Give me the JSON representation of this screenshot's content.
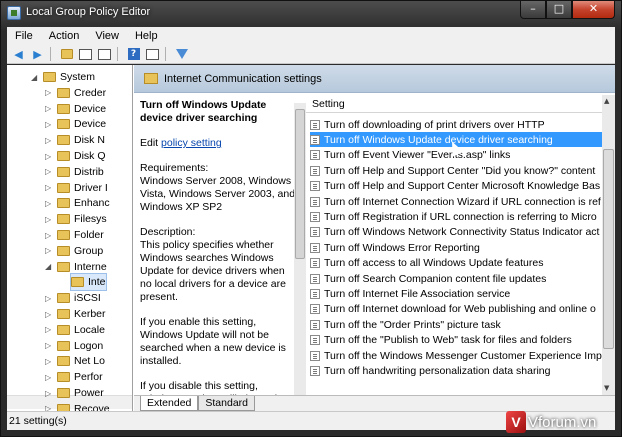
{
  "window": {
    "title": "Local Group Policy Editor"
  },
  "window_buttons": {
    "minimize": "–",
    "maximize": "□",
    "close": "✕"
  },
  "menu": [
    "File",
    "Action",
    "View",
    "Help"
  ],
  "tree": {
    "items": [
      {
        "label": "System",
        "expanded": true
      },
      {
        "label": "Creder"
      },
      {
        "label": "Device"
      },
      {
        "label": "Device"
      },
      {
        "label": "Disk N"
      },
      {
        "label": "Disk Q"
      },
      {
        "label": "Distrib"
      },
      {
        "label": "Driver I"
      },
      {
        "label": "Enhanc"
      },
      {
        "label": "Filesys"
      },
      {
        "label": "Folder"
      },
      {
        "label": "Group"
      },
      {
        "label": "Interne",
        "expanded": true
      },
      {
        "label": "Inte",
        "selected": true
      },
      {
        "label": "iSCSI"
      },
      {
        "label": "Kerber"
      },
      {
        "label": "Locale"
      },
      {
        "label": "Logon"
      },
      {
        "label": "Net Lo"
      },
      {
        "label": "Perfor"
      },
      {
        "label": "Power"
      },
      {
        "label": "Recove"
      }
    ]
  },
  "header": {
    "title": "Internet Communication settings"
  },
  "description": {
    "title": "Turn off Windows Update device driver searching",
    "edit_prefix": "Edit",
    "edit_link": "policy setting",
    "requirements": "Requirements:\nWindows Server 2008, Windows Vista, Windows Server 2003, and Windows XP SP2",
    "body1": "Description:\nThis policy specifies whether Windows searches Windows Update for device drivers when no local drivers for a device are present.",
    "body2": "If you enable this setting, Windows Update will not be searched when a new device is installed.",
    "body3": "If you disable this setting, Windows Update will always be"
  },
  "list": {
    "column": "Setting",
    "selected_index": 1,
    "rows": [
      "Turn off downloading of print drivers over HTTP",
      "Turn off Windows Update device driver searching",
      "Turn off Event Viewer \"Events.asp\" links",
      "Turn off Help and Support Center \"Did you know?\" content",
      "Turn off Help and Support Center Microsoft Knowledge Bas",
      "Turn off Internet Connection Wizard if URL connection is ref",
      "Turn off Registration if URL connection is referring to Micro",
      "Turn off Windows Network Connectivity Status Indicator act",
      "Turn off Windows Error Reporting",
      "Turn off access to all Windows Update features",
      "Turn off Search Companion content file updates",
      "Turn off Internet File Association service",
      "Turn off Internet download for Web publishing and online o",
      "Turn off the \"Order Prints\" picture task",
      "Turn off the \"Publish to Web\" task for files and folders",
      "Turn off the Windows Messenger Customer Experience Impr",
      "Turn off handwriting personalization data sharing"
    ]
  },
  "tabs": {
    "extended": "Extended",
    "standard": "Standard"
  },
  "status": {
    "text": "21 setting(s)"
  },
  "watermark": {
    "logo": "V",
    "text": "Vforum.vn"
  },
  "colors": {
    "selection": "#3399ff",
    "link": "#0645ad",
    "header_band": "#c4d4e4"
  }
}
